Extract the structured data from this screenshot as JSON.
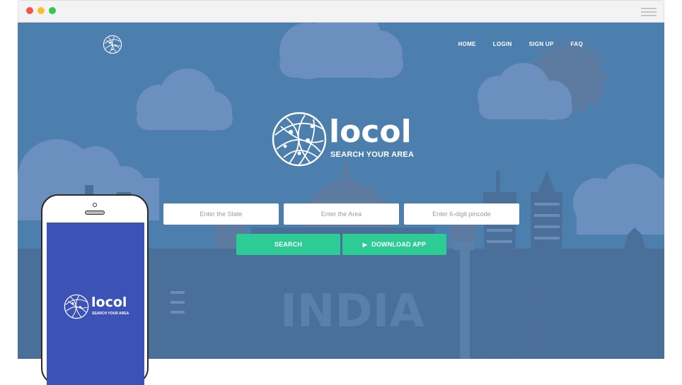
{
  "window": {
    "controls": [
      "close",
      "minimize",
      "maximize"
    ],
    "menu_icon": "hamburger-icon"
  },
  "nav": {
    "items": [
      {
        "label": "HOME"
      },
      {
        "label": "LOGIN"
      },
      {
        "label": "SIGN UP"
      },
      {
        "label": "FAQ"
      }
    ]
  },
  "brand": {
    "name": "locol",
    "tagline": "SEARCH YOUR AREA",
    "logo_icon": "globe-network-icon"
  },
  "search": {
    "state_placeholder": "Enter the State",
    "area_placeholder": "Enter the Area",
    "pincode_placeholder": "Enter 6-digit pincode",
    "search_label": "SEARCH",
    "download_label": "DOWNLOAD APP",
    "download_icon": "play-icon"
  },
  "scene": {
    "skyline_text": "INDIA"
  },
  "phone": {
    "name": "locol",
    "tagline": "SEARCH YOUR AREA"
  },
  "colors": {
    "hero_bg": "#4c7fae",
    "accent_green": "#2ecc95",
    "phone_screen": "#3d52b7"
  }
}
